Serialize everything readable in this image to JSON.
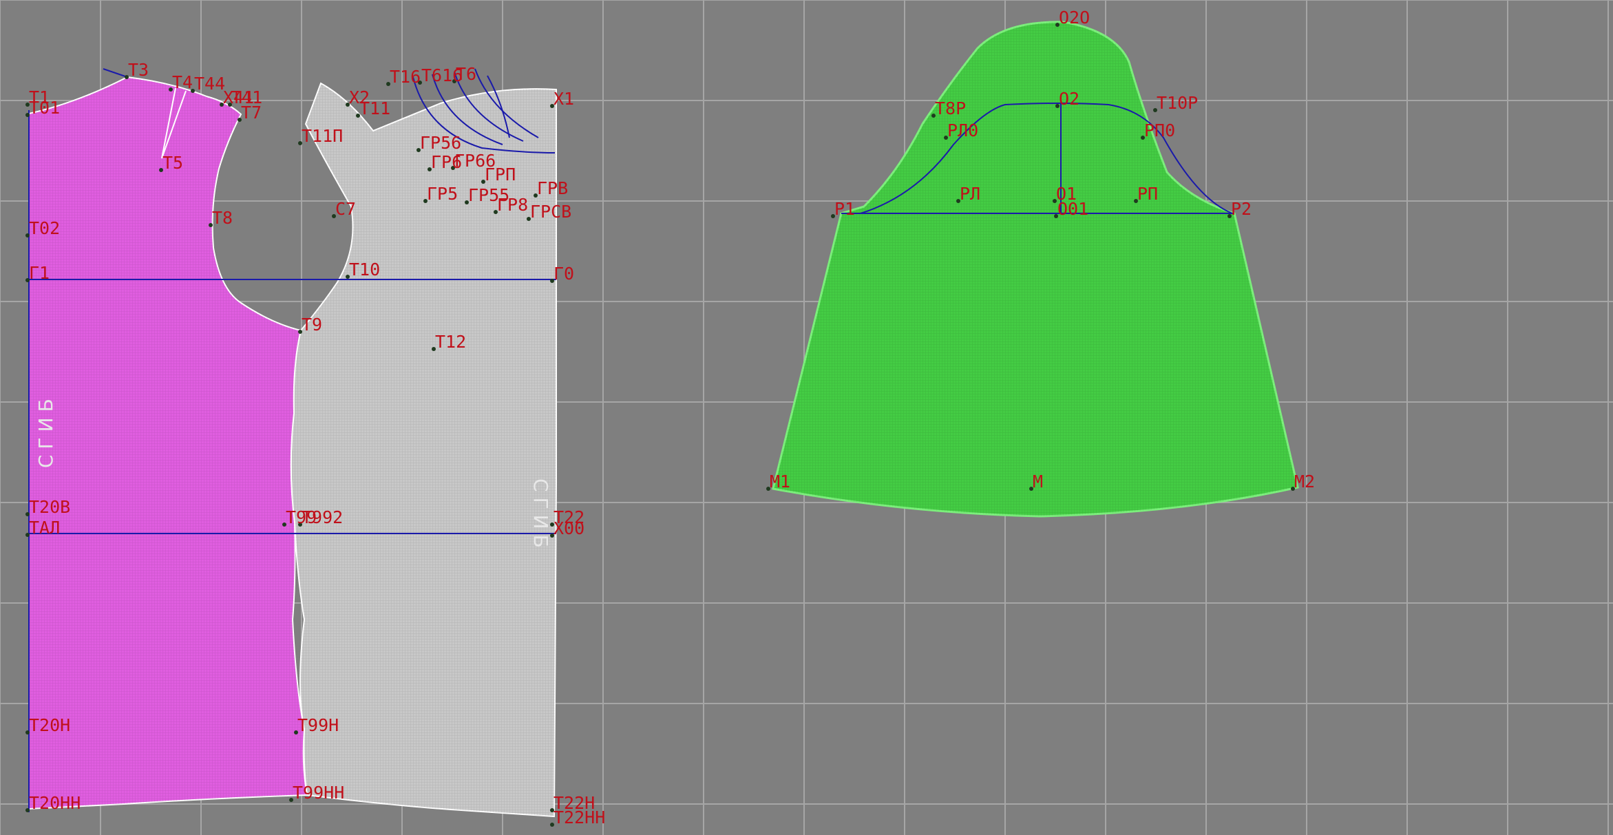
{
  "colors": {
    "background": "#7f7f7f",
    "grid": "#a6a6a6",
    "back_piece": "#e05ee0",
    "front_piece": "#c8c8c8",
    "sleeve_piece": "#44cc44",
    "construction_line": "#1a1aaa",
    "outline": "#ffffff",
    "label": "#c0101a"
  },
  "fold_labels": {
    "back": "СГИБ",
    "front": "СГИБ"
  },
  "back_labels": {
    "t1": "Т1",
    "t01": "Т01",
    "t3": "Т3",
    "t4": "Т4",
    "t44": "Т44",
    "x41": "Х41",
    "t41": "Т41",
    "t7": "Т7",
    "t5": "Т5",
    "t8": "Т8",
    "t02": "Т02",
    "g1": "Г1",
    "t9": "Т9",
    "t20v": "Т20В",
    "tal": "ТАЛ",
    "t20n": "Т20Н",
    "t20nn": "Т20НН"
  },
  "front_labels": {
    "x2": "Х2",
    "t11": "Т11",
    "t11p": "Т11П",
    "c7": "С7",
    "t10": "Т10",
    "t12": "Т12",
    "x1": "Х1",
    "g0": "Г0",
    "t22": "Т22",
    "x00": "Х00",
    "t22n": "Т22Н",
    "t22nn": "Т22НН",
    "t99": "Т99",
    "t992": "Т992",
    "t99n": "Т99Н",
    "t99nn": "Т99НН",
    "t16": "Т16",
    "t616": "Т616",
    "t6": "Т6",
    "gr56": "ГР56",
    "gr6": "ГР6",
    "gr66": "ГР66",
    "grp": "ГРП",
    "gr5": "ГР5",
    "gr55": "ГР55",
    "grv": "ГРВ",
    "gr8": "ГР8",
    "grcv": "ГРСВ"
  },
  "sleeve_labels": {
    "o2o": "О2О",
    "o2": "О2",
    "t8r": "Т8Р",
    "t10r": "Т10Р",
    "rl0": "РЛ0",
    "rp0": "РП0",
    "p1": "Р1",
    "p2": "Р2",
    "rl": "РЛ",
    "rp": "РП",
    "o1": "О1",
    "o01": "О01",
    "m1": "М1",
    "m": "М",
    "m2": "М2"
  }
}
